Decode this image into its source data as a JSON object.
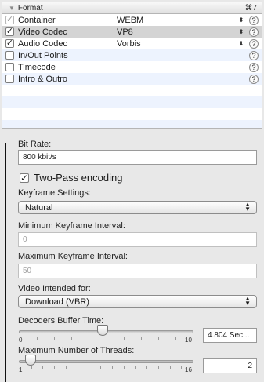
{
  "table": {
    "header": {
      "title": "Format",
      "shortcut": "⌘7"
    },
    "rows": [
      {
        "name": "Container",
        "value": "WEBM",
        "checked": true,
        "disabled": true
      },
      {
        "name": "Video Codec",
        "value": "VP8",
        "checked": true,
        "disabled": false
      },
      {
        "name": "Audio Codec",
        "value": "Vorbis",
        "checked": true,
        "disabled": false
      },
      {
        "name": "In/Out Points",
        "value": "",
        "checked": false,
        "disabled": false
      },
      {
        "name": "Timecode",
        "value": "",
        "checked": false,
        "disabled": false
      },
      {
        "name": "Intro & Outro",
        "value": "",
        "checked": false,
        "disabled": false
      }
    ],
    "help_glyph": "?"
  },
  "settings": {
    "bitrate_label": "Bit Rate:",
    "bitrate_value": "800 kbit/s",
    "twopass_label": "Two-Pass encoding",
    "twopass_checked": true,
    "keyframe_label": "Keyframe Settings:",
    "keyframe_value": "Natural",
    "min_kf_label": "Minimum Keyframe Interval:",
    "min_kf_value": "0",
    "max_kf_label": "Maximum Keyframe Interval:",
    "max_kf_value": "50",
    "video_intended_label": "Video Intended for:",
    "video_intended_value": "Download (VBR)",
    "decoders_label": "Decoders Buffer Time:",
    "decoders_min": "0",
    "decoders_max": "10",
    "decoders_value": "4.804 Sec...",
    "decoders_level": 0.48,
    "threads_label": "Maximum Number of Threads:",
    "threads_min": "1",
    "threads_max": "16",
    "threads_value": "2",
    "threads_level": 0.067
  },
  "colors": {
    "row_alt": "#edf3fe",
    "row_selected": "#d4d4d4",
    "panel_bg": "#e8e8e8"
  }
}
